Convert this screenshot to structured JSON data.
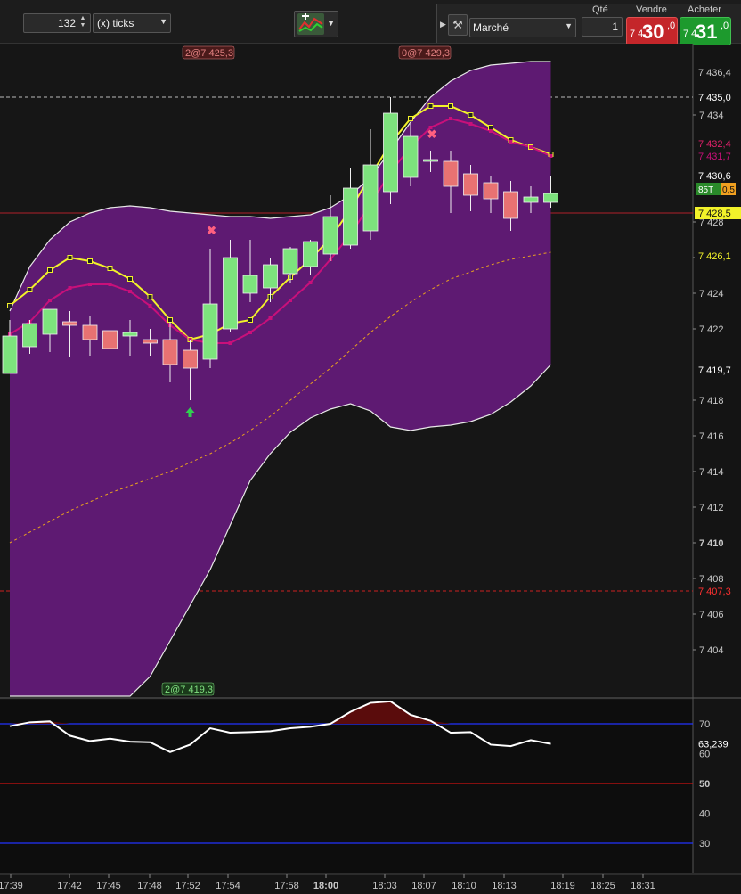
{
  "toolbar": {
    "period_value": "132",
    "period_unit": "(x) ticks",
    "order_type": "Marché",
    "qty_label": "Qté",
    "qty_value": "1",
    "sell_label": "Vendre",
    "buy_label": "Acheter",
    "sell_price": {
      "prefix": "7 4",
      "big": "30",
      "decimal": ",0"
    },
    "buy_price": {
      "prefix": "7 4",
      "big": "31",
      "decimal": ",0"
    }
  },
  "colors": {
    "background": "#141414",
    "band_fill": "#5e1a72",
    "up_candle": "#7de27d",
    "down_candle": "#e87272",
    "yellow_line": "#f2f22a",
    "magenta_line": "#c8107a",
    "rsi_line": "#ffffff",
    "hline_blue": "#2233ff",
    "hline_red": "#cc1111",
    "sell_red": "#c4262a",
    "buy_green": "#1d9a2d"
  },
  "chart_data": [
    {
      "type": "candlestick",
      "x_tick_labels": [
        "17:39",
        "17:42",
        "17:45",
        "17:48",
        "17:52",
        "17:54",
        "17:58",
        "18:00",
        "18:03",
        "18:07",
        "18:10",
        "18:13",
        "18:19",
        "18:25",
        "18:31"
      ],
      "y_tick_labels": [
        "7 434",
        "7 428",
        "7 426",
        "7 424",
        "7 422",
        "7 418",
        "7 416",
        "7 414",
        "7 412",
        "7 410",
        "7 408",
        "7 406",
        "7 404"
      ],
      "ylim": [
        7400.9,
        7436.9
      ],
      "candles": [
        {
          "o": 7419.5,
          "h": 7422.5,
          "l": 7419.5,
          "c": 7421.6
        },
        {
          "o": 7421.0,
          "h": 7422.5,
          "l": 7420.6,
          "c": 7422.3
        },
        {
          "o": 7421.7,
          "h": 7423.0,
          "l": 7420.7,
          "c": 7423.1
        },
        {
          "o": 7422.4,
          "h": 7423.0,
          "l": 7420.4,
          "c": 7422.2
        },
        {
          "o": 7422.2,
          "h": 7422.7,
          "l": 7420.5,
          "c": 7421.4
        },
        {
          "o": 7421.9,
          "h": 7422.2,
          "l": 7420.0,
          "c": 7420.9
        },
        {
          "o": 7421.6,
          "h": 7422.5,
          "l": 7420.5,
          "c": 7421.8
        },
        {
          "o": 7421.4,
          "h": 7422.0,
          "l": 7420.5,
          "c": 7421.2
        },
        {
          "o": 7421.4,
          "h": 7422.4,
          "l": 7419.0,
          "c": 7420.0
        },
        {
          "o": 7420.8,
          "h": 7421.4,
          "l": 7418.0,
          "c": 7419.8
        },
        {
          "o": 7420.3,
          "h": 7426.5,
          "l": 7419.8,
          "c": 7423.4
        },
        {
          "o": 7422.0,
          "h": 7427.0,
          "l": 7421.8,
          "c": 7426.0
        },
        {
          "o": 7424.0,
          "h": 7427.0,
          "l": 7423.5,
          "c": 7425.0
        },
        {
          "o": 7424.3,
          "h": 7426.0,
          "l": 7423.5,
          "c": 7425.6
        },
        {
          "o": 7425.1,
          "h": 7426.6,
          "l": 7424.6,
          "c": 7426.5
        },
        {
          "o": 7425.5,
          "h": 7427.0,
          "l": 7425.0,
          "c": 7426.9
        },
        {
          "o": 7426.2,
          "h": 7429.5,
          "l": 7425.8,
          "c": 7428.3
        },
        {
          "o": 7426.7,
          "h": 7431.0,
          "l": 7426.5,
          "c": 7429.9
        },
        {
          "o": 7427.5,
          "h": 7433.2,
          "l": 7427.0,
          "c": 7431.2
        },
        {
          "o": 7429.7,
          "h": 7435.0,
          "l": 7429.0,
          "c": 7434.1
        },
        {
          "o": 7430.5,
          "h": 7433.5,
          "l": 7430.0,
          "c": 7432.8
        },
        {
          "o": 7431.4,
          "h": 7432.0,
          "l": 7430.8,
          "c": 7431.5
        },
        {
          "o": 7431.4,
          "h": 7432.0,
          "l": 7428.5,
          "c": 7430.0
        },
        {
          "o": 7430.7,
          "h": 7431.2,
          "l": 7428.6,
          "c": 7429.5
        },
        {
          "o": 7430.2,
          "h": 7430.6,
          "l": 7428.5,
          "c": 7429.3
        },
        {
          "o": 7429.7,
          "h": 7430.3,
          "l": 7427.5,
          "c": 7428.2
        },
        {
          "o": 7429.1,
          "h": 7430.0,
          "l": 7428.5,
          "c": 7429.4
        },
        {
          "o": 7429.1,
          "h": 7430.6,
          "l": 7428.8,
          "c": 7429.6
        }
      ],
      "bollinger_upper": [
        7423.0,
        7425.5,
        7427.0,
        7428.0,
        7428.5,
        7428.8,
        7428.9,
        7428.8,
        7428.6,
        7428.5,
        7428.4,
        7428.3,
        7428.3,
        7428.2,
        7428.3,
        7428.4,
        7428.8,
        7429.5,
        7430.5,
        7432.0,
        7433.6,
        7435.0,
        7435.9,
        7436.5,
        7436.8,
        7436.9,
        7437.0,
        7437.0
      ],
      "bollinger_lower": [
        7377.0,
        7382.0,
        7387.0,
        7391.0,
        7394.5,
        7397.5,
        7400.0,
        7402.5,
        7404.5,
        7406.5,
        7408.5,
        7411.0,
        7413.5,
        7415.0,
        7416.2,
        7417.0,
        7417.5,
        7417.8,
        7417.4,
        7416.5,
        7416.3,
        7416.5,
        7416.6,
        7416.8,
        7417.2,
        7417.9,
        7418.8,
        7420.0
      ],
      "bollinger_mid": [
        7410.0,
        7410.6,
        7411.2,
        7411.8,
        7412.3,
        7412.8,
        7413.2,
        7413.6,
        7414.0,
        7414.5,
        7415.0,
        7415.6,
        7416.3,
        7417.1,
        7418.0,
        7418.9,
        7419.8,
        7420.8,
        7421.8,
        7422.7,
        7423.5,
        7424.2,
        7424.8,
        7425.2,
        7425.6,
        7425.9,
        7426.1,
        7426.3
      ],
      "yellow_ema": [
        7423.3,
        7424.2,
        7425.3,
        7426.0,
        7425.8,
        7425.4,
        7424.8,
        7423.8,
        7422.5,
        7421.4,
        7421.7,
        7422.3,
        7422.5,
        7423.8,
        7424.9,
        7425.9,
        7427.1,
        7428.7,
        7430.6,
        7432.4,
        7433.8,
        7434.5,
        7434.5,
        7434.0,
        7433.3,
        7432.6,
        7432.2,
        7431.8
      ],
      "magenta_ema": [
        7421.7,
        7422.4,
        7423.6,
        7424.3,
        7424.5,
        7424.5,
        7424.1,
        7423.3,
        7422.2,
        7421.4,
        7421.2,
        7421.2,
        7421.8,
        7422.6,
        7423.6,
        7424.6,
        7425.9,
        7427.3,
        7429.0,
        7430.8,
        7432.2,
        7433.3,
        7433.8,
        7433.5,
        7433.1,
        7432.5,
        7432.2,
        7431.7
      ],
      "price_tags": [
        {
          "text": "7 436,4",
          "color": "#c8c8c8",
          "bg": "#141414"
        },
        {
          "text": "7 435,0",
          "color": "#ffffff",
          "bg": "#141414"
        },
        {
          "text": "7 432,4",
          "color": "#e0206a",
          "bg": "#141414"
        },
        {
          "text": "7 431,7",
          "color": "#c8107a",
          "bg": "#141414"
        },
        {
          "text": "7 430,6",
          "color": "#ffffff",
          "bg": "#141414"
        },
        {
          "text": "7 428,5",
          "color": "#111111",
          "bg": "#f2f22a"
        },
        {
          "text": "7 426,1",
          "color": "#f2f22a",
          "bg": "#141414"
        },
        {
          "text": "7 419,7",
          "color": "#ffffff",
          "bg": "#141414"
        },
        {
          "text": "7 407,3",
          "color": "#ff3030",
          "bg": "#141414"
        }
      ],
      "annotations": [
        "2@7 425,3",
        "0@7 429,3",
        "2@7 419,3"
      ],
      "current_badge": {
        "left": "85T",
        "right": "0,5"
      }
    },
    {
      "type": "line",
      "name": "RSI",
      "ylim": [
        25,
        78
      ],
      "y_tick_labels": [
        "70",
        "60",
        "50",
        "40",
        "30"
      ],
      "levels": [
        70,
        50,
        30
      ],
      "values": [
        69.2,
        70.5,
        70.8,
        66.0,
        64.2,
        65.0,
        64.0,
        63.8,
        60.5,
        63.0,
        68.5,
        67.0,
        67.2,
        67.5,
        68.5,
        69.0,
        70.0,
        74.0,
        77.0,
        77.5,
        73.0,
        71.0,
        67.0,
        67.2,
        63.0,
        62.5,
        64.5,
        63.239
      ],
      "current_value_label": "63,239"
    }
  ]
}
